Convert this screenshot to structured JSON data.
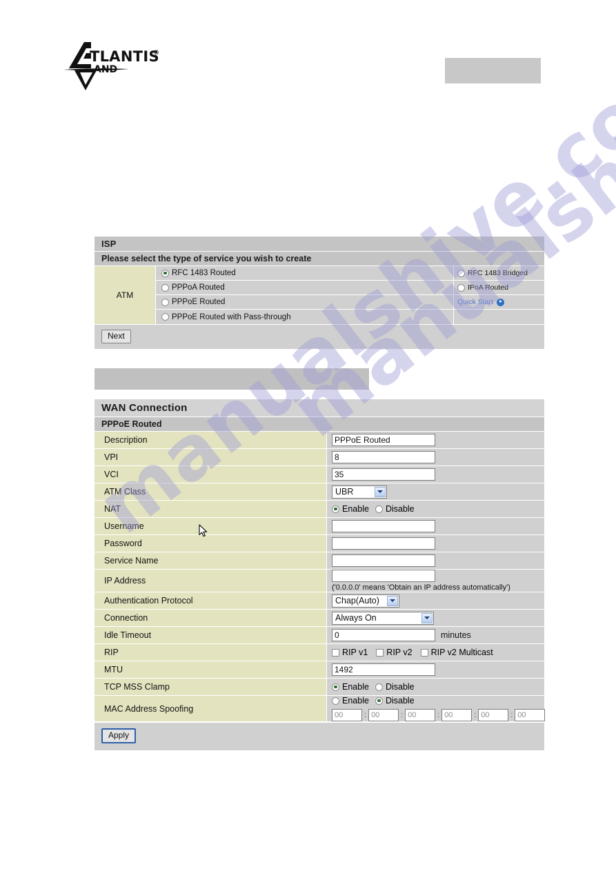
{
  "header": {
    "logo_name": "ATLANTIS LAND",
    "logo_primary_text": "TLANTIS",
    "logo_registered_mark": "®",
    "logo_secondary_text": "AND"
  },
  "watermark": {
    "line1": "manualshive.com",
    "line2": "manualshive.com",
    "color": "#9d9ad6"
  },
  "isp_panel": {
    "title": "ISP",
    "subtitle": "Please select the type of service you wish to create",
    "group_label": "ATM",
    "left_options": [
      {
        "label": "RFC 1483 Routed",
        "selected": true
      },
      {
        "label": "PPPoA Routed",
        "selected": false
      },
      {
        "label": "PPPoE Routed",
        "selected": false
      },
      {
        "label": "PPPoE Routed with Pass-through",
        "selected": false
      }
    ],
    "right_options": [
      {
        "label": "RFC 1483 Bridged",
        "selected": false
      },
      {
        "label": "IPoA Routed",
        "selected": false
      }
    ],
    "quick_start_label": "Quick Start",
    "quick_start_color": "#4f74c8",
    "next_button": "Next"
  },
  "wan_panel": {
    "title": "WAN Connection",
    "subtitle": "PPPoE Routed",
    "rows": {
      "description": {
        "label": "Description",
        "value": "PPPoE Routed"
      },
      "vpi": {
        "label": "VPI",
        "value": "8"
      },
      "vci": {
        "label": "VCI",
        "value": "35"
      },
      "atm_class": {
        "label": "ATM Class",
        "value": "UBR"
      },
      "nat": {
        "label": "NAT",
        "enable_label": "Enable",
        "disable_label": "Disable",
        "selected": "Enable"
      },
      "username": {
        "label": "Username",
        "value": ""
      },
      "password": {
        "label": "Password",
        "value": ""
      },
      "service_name": {
        "label": "Service Name",
        "value": ""
      },
      "ip_address": {
        "label": "IP Address",
        "value": "",
        "hint": "('0.0.0.0' means 'Obtain an IP address automatically')"
      },
      "auth_protocol": {
        "label": "Authentication Protocol",
        "value": "Chap(Auto)"
      },
      "connection": {
        "label": "Connection",
        "value": "Always On"
      },
      "idle_timeout": {
        "label": "Idle Timeout",
        "value": "0",
        "suffix": "minutes"
      },
      "rip": {
        "label": "RIP",
        "options": [
          {
            "label": "RIP v1",
            "checked": false
          },
          {
            "label": "RIP v2",
            "checked": false
          },
          {
            "label": "RIP v2 Multicast",
            "checked": false
          }
        ]
      },
      "mtu": {
        "label": "MTU",
        "value": "1492"
      },
      "tcp_mss_clamp": {
        "label": "TCP MSS Clamp",
        "enable_label": "Enable",
        "disable_label": "Disable",
        "selected": "Enable"
      },
      "mac_spoofing": {
        "label": "MAC Address Spoofing",
        "enable_label": "Enable",
        "disable_label": "Disable",
        "selected": "Disable",
        "octets": [
          "00",
          "00",
          "00",
          "00",
          "00",
          "00"
        ],
        "separator": ":"
      }
    },
    "apply_button": "Apply"
  },
  "colors": {
    "label_cell": "#e3e3c0",
    "value_cell": "#d0d0d0",
    "header_bar": "#c4c4c4",
    "link": "#4f74c8"
  }
}
